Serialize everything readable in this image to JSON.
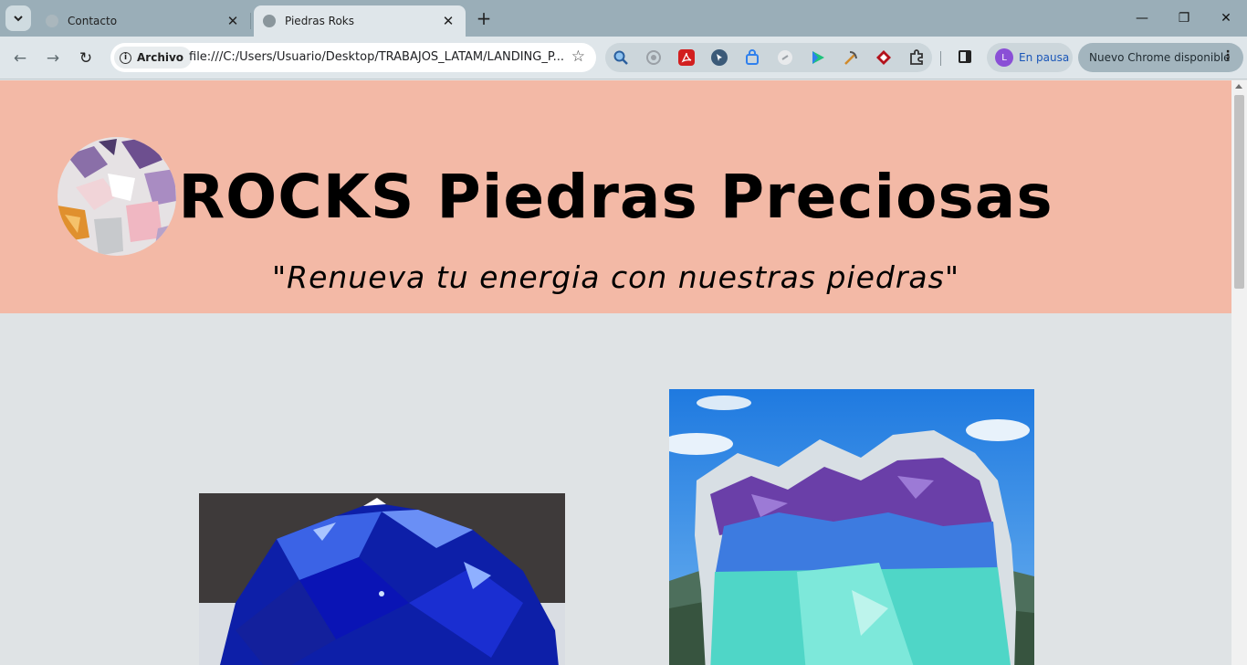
{
  "browser": {
    "tabs": [
      {
        "title": "Contacto",
        "active": false
      },
      {
        "title": "Piedras Roks",
        "active": true
      }
    ],
    "tab_close_glyph": "✕",
    "new_tab_glyph": "+",
    "window_controls": {
      "minimize": "—",
      "restore": "❐",
      "close": "✕"
    },
    "nav": {
      "back": "←",
      "forward": "→",
      "reload": "↻"
    },
    "security_chip": "Archivo",
    "url": "file:///C:/Users/Usuario/Desktop/TRABAJOS_LATAM/LANDING_P...",
    "bookmark_glyph": "☆",
    "extensions": [
      {
        "icon": "magnifier-extension-icon",
        "color": "#3a7bd5"
      },
      {
        "icon": "target-extension-icon",
        "color": "#9aa0a6"
      },
      {
        "icon": "pdf-extension-icon",
        "color": "#d21f1f"
      },
      {
        "icon": "cursor-extension-icon",
        "color": "#3b5a78"
      },
      {
        "icon": "bag-extension-icon",
        "color": "#2f80ed"
      },
      {
        "icon": "link-extension-icon",
        "color": "#c8ccd0"
      },
      {
        "icon": "play-extension-icon",
        "color": "#1ec27c"
      },
      {
        "icon": "pickaxe-extension-icon",
        "color": "#d08a2a"
      },
      {
        "icon": "diamond-extension-icon",
        "color": "#b3121c"
      },
      {
        "icon": "puzzle-extension-icon",
        "color": "#333333"
      }
    ],
    "profile": {
      "initial": "L",
      "status": "En pausa",
      "color": "#8a4fd6"
    },
    "update_button": "Nuevo Chrome disponible"
  },
  "page": {
    "title_brand": "ROCKS",
    "title_rest": " Piedras Preciosas",
    "subtitle": "\"Renueva tu energia con nuestras piedras\"",
    "colors": {
      "header_bg": "#f3b9a6",
      "page_bg": "#dfe3e5"
    }
  }
}
